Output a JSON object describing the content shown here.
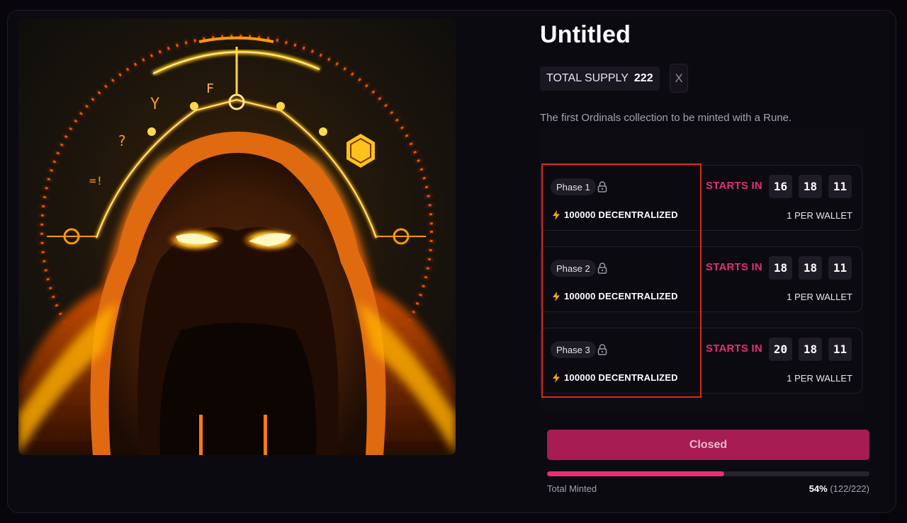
{
  "collection": {
    "title": "Untitled",
    "supply_label": "TOTAL SUPPLY",
    "supply_value": "222",
    "social_link": "X",
    "description": "The first Ordinals collection to be minted with a Rune."
  },
  "artwork": {
    "icon": "hooded-figure-artwork",
    "accent": "#ffb31a"
  },
  "phases": [
    {
      "name": "Phase 1",
      "price": "100000 DECENTRALIZED",
      "starts_label": "STARTS IN",
      "countdown": [
        "16",
        "18",
        "11"
      ],
      "limit": "1 PER WALLET"
    },
    {
      "name": "Phase 2",
      "price": "100000 DECENTRALIZED",
      "starts_label": "STARTS IN",
      "countdown": [
        "18",
        "18",
        "11"
      ],
      "limit": "1 PER WALLET"
    },
    {
      "name": "Phase 3",
      "price": "100000 DECENTRALIZED",
      "starts_label": "STARTS IN",
      "countdown": [
        "20",
        "18",
        "11"
      ],
      "limit": "1 PER WALLET"
    }
  ],
  "mint": {
    "button_label": "Closed",
    "progress_label": "Total Minted",
    "percent": "54%",
    "count": "(122/222)",
    "progress_fraction": 0.55
  },
  "colors": {
    "accent": "#e0326e",
    "button": "#a71c53",
    "highlight_box": "#e0261c"
  }
}
